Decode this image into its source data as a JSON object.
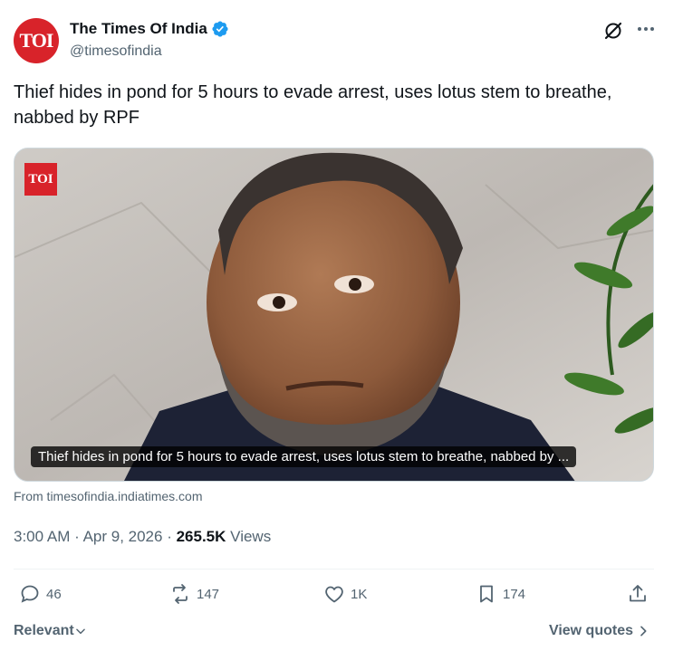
{
  "account": {
    "avatar_text": "TOI",
    "name": "The Times Of India",
    "handle": "@timesofindia",
    "verified": true
  },
  "tweet": {
    "text": "Thief hides in pond for 5 hours to evade arrest, uses lotus stem to breathe, nabbed by RPF"
  },
  "media": {
    "badge_text": "TOI",
    "caption": "Thief hides in pond for 5 hours to evade arrest, uses lotus stem to breathe, nabbed by ..."
  },
  "card": {
    "source": "From timesofindia.indiatimes.com"
  },
  "meta": {
    "time": "3:00 AM",
    "date": "Apr 9, 2026",
    "views_count": "265.5K",
    "views_label": "Views"
  },
  "actions": {
    "replies": "46",
    "reposts": "147",
    "likes": "1K",
    "bookmarks": "174"
  },
  "footer": {
    "sort_label": "Relevant",
    "quotes_label": "View quotes"
  },
  "colors": {
    "brand_red": "#d8232a",
    "verified_blue": "#1d9bf0",
    "secondary_text": "#536471"
  }
}
